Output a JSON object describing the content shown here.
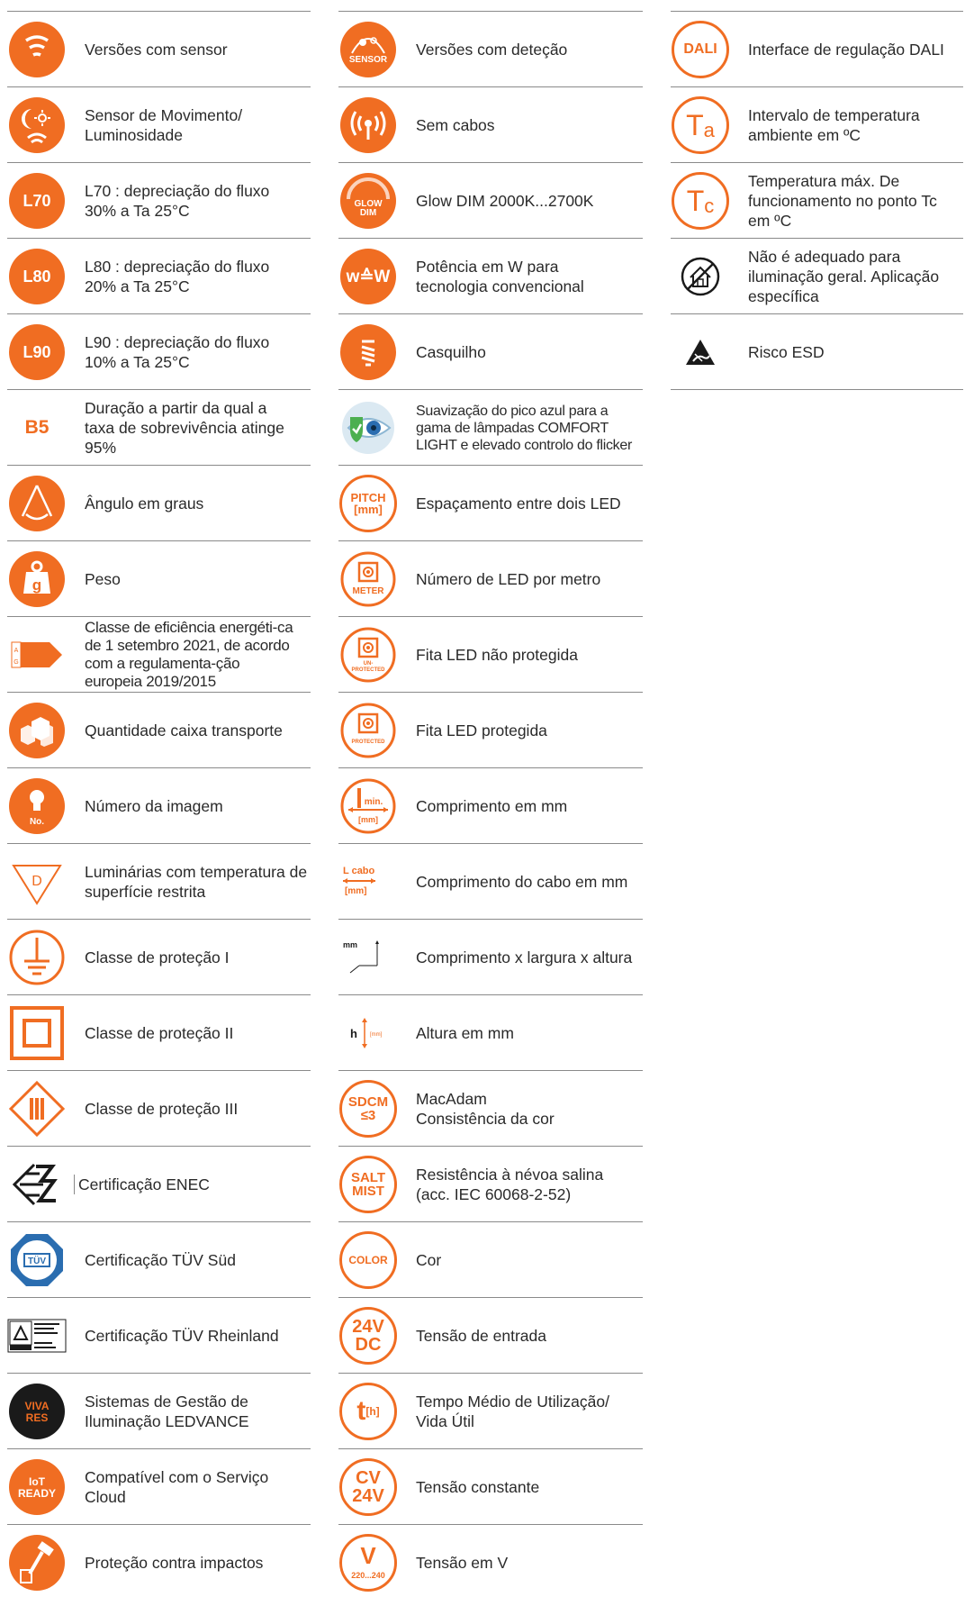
{
  "col1": [
    {
      "label": "Versões com sensor",
      "icon": "sensor-waves-icon"
    },
    {
      "label": "Sensor de Movimento/ Luminosidade",
      "icon": "motion-light-sensor-icon"
    },
    {
      "label": "L70 : depreciação do fluxo 30% a Ta 25°C",
      "icon": "l70-icon",
      "badge": "L70"
    },
    {
      "label": "L80 : depreciação do fluxo 20% a Ta 25°C",
      "icon": "l80-icon",
      "badge": "L80"
    },
    {
      "label": "L90 : depreciação do fluxo 10% a Ta 25°C",
      "icon": "l90-icon",
      "badge": "L90"
    },
    {
      "label": "Duração a partir da qual a taxa de sobrevivência atinge 95%",
      "icon": "b5-icon",
      "badge": "B5"
    },
    {
      "label": "Ângulo em graus",
      "icon": "beam-angle-icon"
    },
    {
      "label": "Peso",
      "icon": "weight-icon",
      "badge": "g"
    },
    {
      "label": "Classe de eficiência energéti-ca de 1 setembro  2021, de acordo com a regulamenta-ção europeia 2019/2015",
      "icon": "energy-class-icon",
      "badge": "A G"
    },
    {
      "label": "Quantidade caixa transporte",
      "icon": "shipping-box-icon"
    },
    {
      "label": "Número da imagem",
      "icon": "image-number-icon",
      "badge": "No."
    },
    {
      "label": "Luminárias com temperatura de superfície restrita",
      "icon": "restricted-surface-temp-icon",
      "badge": "D"
    },
    {
      "label": "Classe de proteção I",
      "icon": "protection-class-1-icon"
    },
    {
      "label": "Classe de proteção II",
      "icon": "protection-class-2-icon"
    },
    {
      "label": "Classe de proteção III",
      "icon": "protection-class-3-icon"
    },
    {
      "label": "Certificação ENEC",
      "icon": "enec-icon"
    },
    {
      "label": "Certificação TÜV Süd",
      "icon": "tuv-sud-icon",
      "badge": "TÜV"
    },
    {
      "label": "Certificação TÜV Rheinland",
      "icon": "tuv-rheinland-icon"
    },
    {
      "label": "Sistemas de Gestão de Iluminação LEDVANCE",
      "icon": "vivares-icon",
      "badge": "VIVA RES"
    },
    {
      "label": "Compatível com o Serviço Cloud",
      "icon": "iot-ready-icon",
      "badge": "IoT READY"
    },
    {
      "label": "Proteção contra impactos",
      "icon": "impact-protection-icon"
    }
  ],
  "col2": [
    {
      "label": "Versões com deteção",
      "icon": "sensor-detection-icon",
      "badge": "SENSOR"
    },
    {
      "label": "Sem cabos",
      "icon": "wireless-icon"
    },
    {
      "label": "Glow DIM 2000K...2700K",
      "icon": "glow-dim-icon",
      "badge": "GLOW DIM"
    },
    {
      "label": "Potência em W para tecnologia convencional",
      "icon": "watt-equivalent-icon",
      "badge": "w≙W"
    },
    {
      "label": "Casquilho",
      "icon": "lamp-base-icon"
    },
    {
      "label": "Suavização do pico azul para a gama de lâmpadas COMFORT LIGHT e elevado controlo do flicker",
      "icon": "comfort-light-eye-icon"
    },
    {
      "label": "Espaçamento entre dois LED",
      "icon": "pitch-icon",
      "badge": "PITCH [mm]"
    },
    {
      "label": "Número de LED por metro",
      "icon": "led-per-meter-icon",
      "badge": "METER"
    },
    {
      "label": "Fita LED não protegida",
      "icon": "led-strip-unprotected-icon",
      "badge": "UN-PROTECTED"
    },
    {
      "label": "Fita LED protegida",
      "icon": "led-strip-protected-icon",
      "badge": "PROTECTED"
    },
    {
      "label": "Comprimento em mm",
      "icon": "length-min-icon",
      "badge": "min. [mm]"
    },
    {
      "label": "Comprimento do cabo em mm",
      "icon": "cable-length-icon",
      "badge": "L cabo [mm]"
    },
    {
      "label": "Comprimento x largura x altura",
      "icon": "dimensions-icon",
      "badge": "mm"
    },
    {
      "label": "Altura em mm",
      "icon": "height-icon",
      "badge": "h [mm]"
    },
    {
      "label": "MacAdam Consistência da cor",
      "icon": "sdcm-icon",
      "badge": "SDCM ≤3"
    },
    {
      "label": "Resistência à névoa salina (acc. IEC 60068-2-52)",
      "icon": "salt-mist-icon",
      "badge": "SALT MIST"
    },
    {
      "label": "Cor",
      "icon": "color-icon",
      "badge": "COLOR"
    },
    {
      "label": "Tensão de entrada",
      "icon": "input-voltage-icon",
      "badge": "24V DC"
    },
    {
      "label": "Tempo Médio de Utilização/ Vida Útil",
      "icon": "lifetime-icon",
      "badge": "t[h]"
    },
    {
      "label": "Tensão constante",
      "icon": "constant-voltage-icon",
      "badge": "CV 24V"
    },
    {
      "label": "Tensão em V",
      "icon": "voltage-icon",
      "badge": "V 220...240"
    }
  ],
  "col3": [
    {
      "label": "Interface de regulação DALI",
      "icon": "dali-icon",
      "badge": "DALI"
    },
    {
      "label": "Intervalo de temperatura ambiente em ºC",
      "icon": "ta-icon",
      "badge": "Ta"
    },
    {
      "label": "Temperatura máx. De funcionamento no ponto Tc em ºC",
      "icon": "tc-icon",
      "badge": "Tc"
    },
    {
      "label": "Não é adequado para iluminação geral. Aplicação específica",
      "icon": "not-general-lighting-icon"
    },
    {
      "label": "Risco ESD",
      "icon": "esd-risk-icon"
    }
  ],
  "colors": {
    "orange": "#f06d22",
    "line": "#8a8a8a",
    "text": "#2a2a2a"
  }
}
